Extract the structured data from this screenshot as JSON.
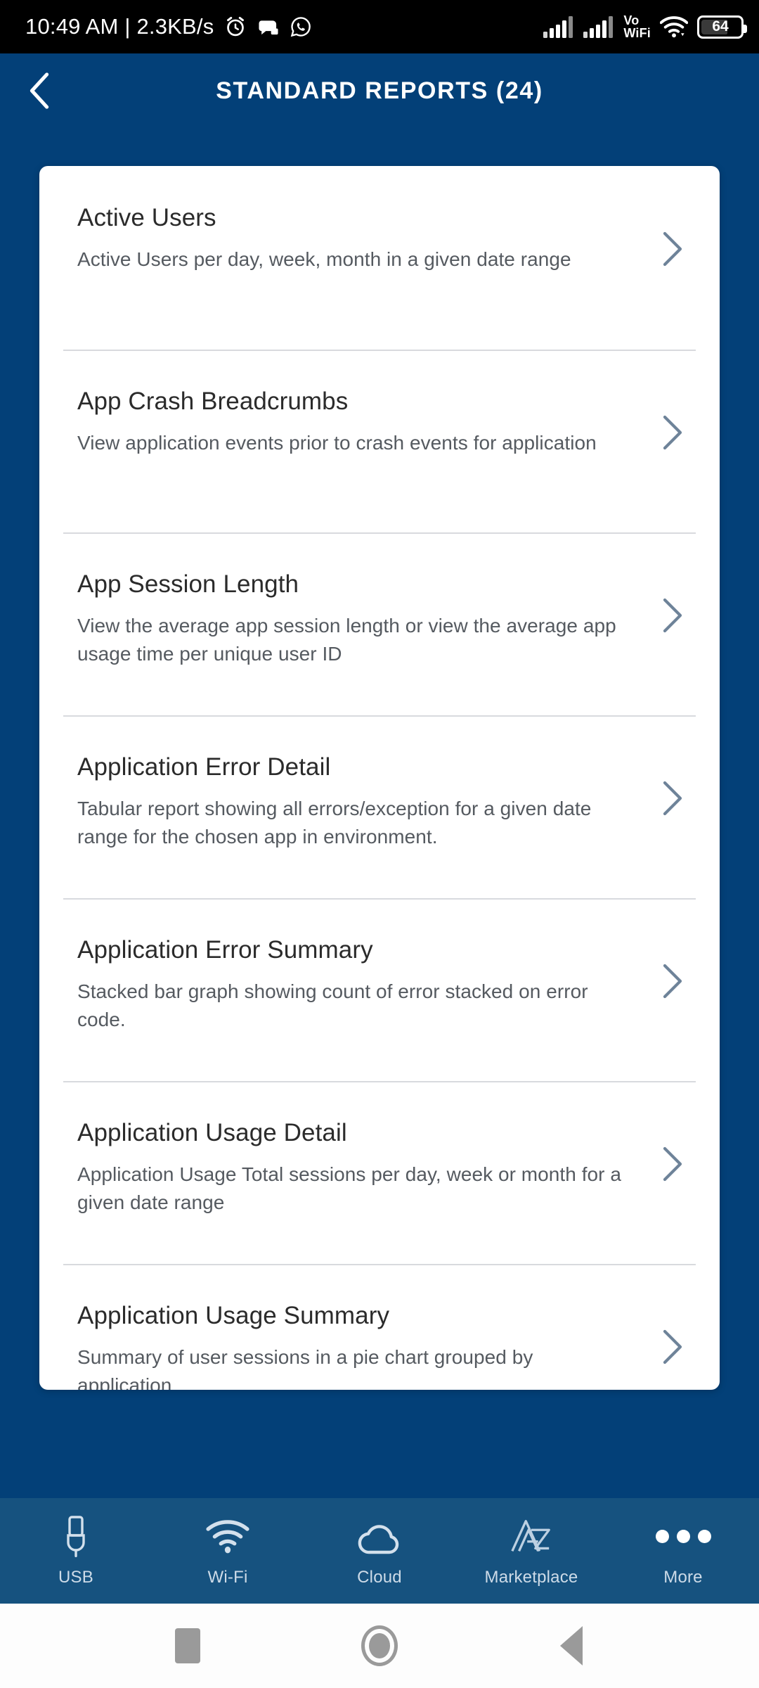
{
  "status_bar": {
    "time": "10:49 AM",
    "separator": "|",
    "network_speed": "2.3KB/s",
    "clock_text": "10:49 AM | 2.3KB/s",
    "icons_left": [
      "alarm-icon",
      "game-chat-icon",
      "whatsapp-icon"
    ],
    "vo_line1": "Vo",
    "vo_line2": "WiFi",
    "icons_right": [
      "signal-bars-sim1-icon",
      "signal-bars-sim2-icon",
      "vowifi-icon",
      "wifi-icon",
      "battery-icon"
    ],
    "battery_level": "64",
    "background_color": "#000000",
    "text_color": "#ffffff"
  },
  "header": {
    "back_label": "Back",
    "back_icon": "chevron-left-icon",
    "title": "STANDARD REPORTS (24)",
    "report_count": "24",
    "background_color": "#034078",
    "text_color": "#ffffff"
  },
  "reports": {
    "chevron_icon": "chevron-right-icon",
    "items": [
      {
        "title": "Active Users",
        "description": "Active Users per day, week, month in a given date range"
      },
      {
        "title": "App Crash Breadcrumbs",
        "description": "View application events prior to crash events for application"
      },
      {
        "title": "App Session Length",
        "description": "View the average app session length or view the average app usage time per unique user ID"
      },
      {
        "title": "Application Error Detail",
        "description": "Tabular report showing all errors/exception for a given date range for the chosen app in environment."
      },
      {
        "title": "Application Error Summary",
        "description": "Stacked bar graph showing count of error stacked on error code."
      },
      {
        "title": "Application Usage Detail",
        "description": "Application Usage Total sessions per day, week or month for a given date range"
      },
      {
        "title": "Application Usage Summary",
        "description": "Summary of user sessions in a pie chart grouped by application"
      }
    ]
  },
  "tab_bar": {
    "background_color": "#16527f",
    "label_color": "#cddbe8",
    "items": [
      {
        "label": "USB",
        "icon": "usb-icon"
      },
      {
        "label": "Wi-Fi",
        "icon": "wifi-icon"
      },
      {
        "label": "Cloud",
        "icon": "cloud-icon"
      },
      {
        "label": "Marketplace",
        "icon": "marketplace-logo-icon"
      },
      {
        "label": "More",
        "icon": "more-dots-icon"
      }
    ]
  },
  "nav_bar": {
    "background_color": "#fdfdfd",
    "items": [
      {
        "name": "recents",
        "icon": "square-icon"
      },
      {
        "name": "home",
        "icon": "circle-icon"
      },
      {
        "name": "back",
        "icon": "triangle-left-icon"
      }
    ]
  },
  "theme": {
    "primary_blue": "#034078",
    "tabbar_blue": "#16527f",
    "card_white": "#ffffff",
    "divider": "#d8dade",
    "title_text": "#2b2b2b",
    "desc_text": "#555a60",
    "chevron": "#6e8399"
  }
}
